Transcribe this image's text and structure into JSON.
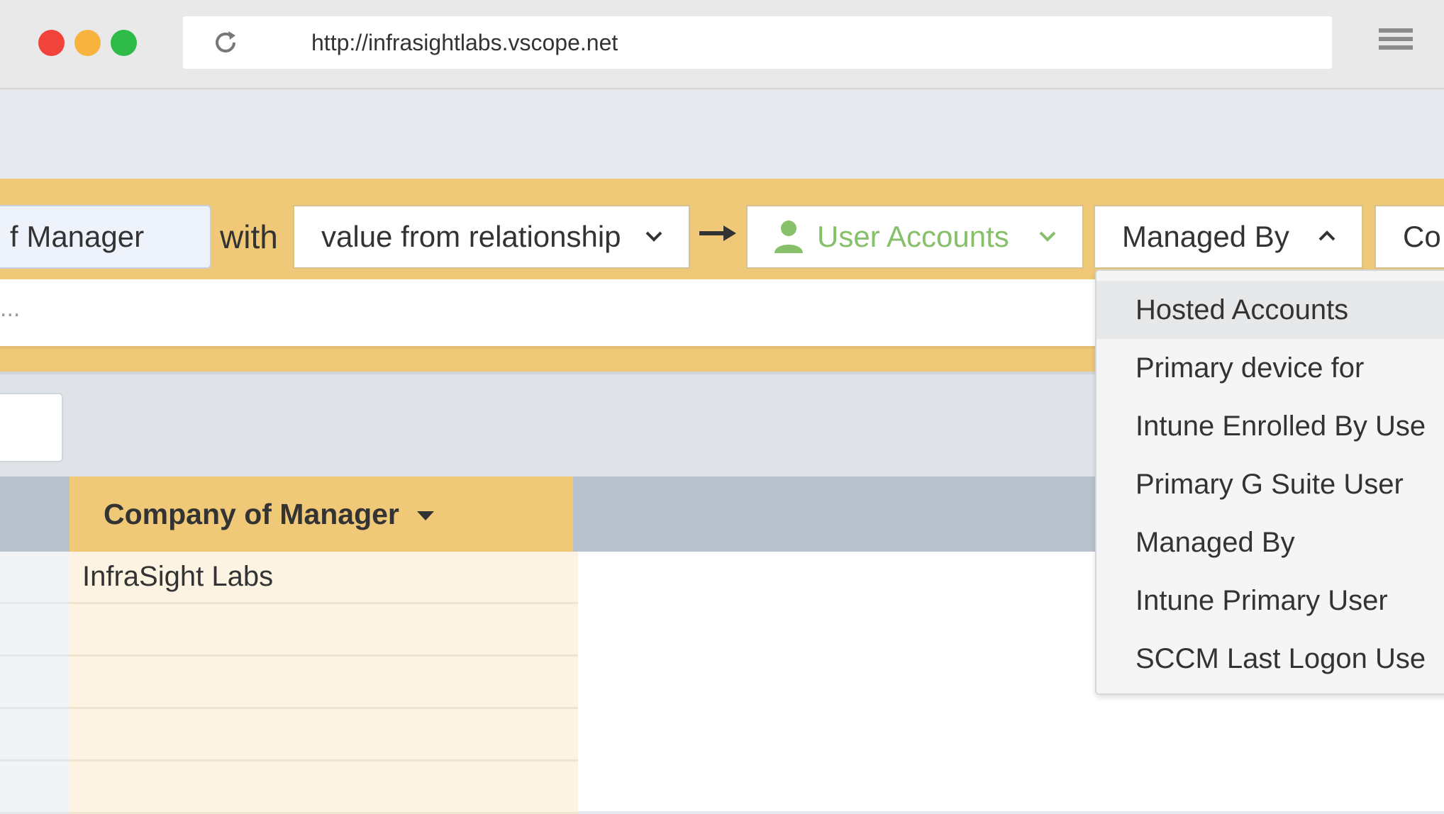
{
  "browser": {
    "url": "http://infrasightlabs.vscope.net",
    "traffic_lights": {
      "close": "#f2433b",
      "minimize": "#f7b33d",
      "zoom": "#2fbb48"
    },
    "reload_icon": "reload-icon",
    "menu_icon": "hamburger-menu-icon"
  },
  "toolbar": {
    "property_field": "f Manager",
    "with_label": "with",
    "mode_select": "value from relationship",
    "target_select": "User Accounts",
    "relationship_select": "Managed By",
    "next_field": "Co",
    "accent_color": "#efc977",
    "target_color": "#86c06b"
  },
  "search_row": {
    "ellipsis": "..."
  },
  "table": {
    "column_header": "Company of Manager",
    "rows": [
      "InfraSight Labs",
      "",
      "",
      "",
      ""
    ]
  },
  "dropdown": {
    "items": [
      "Hosted Accounts",
      "Primary device for",
      "Intune Enrolled By Use",
      "Primary G Suite User",
      "Managed By",
      "Intune Primary User",
      "SCCM Last Logon Use"
    ]
  }
}
